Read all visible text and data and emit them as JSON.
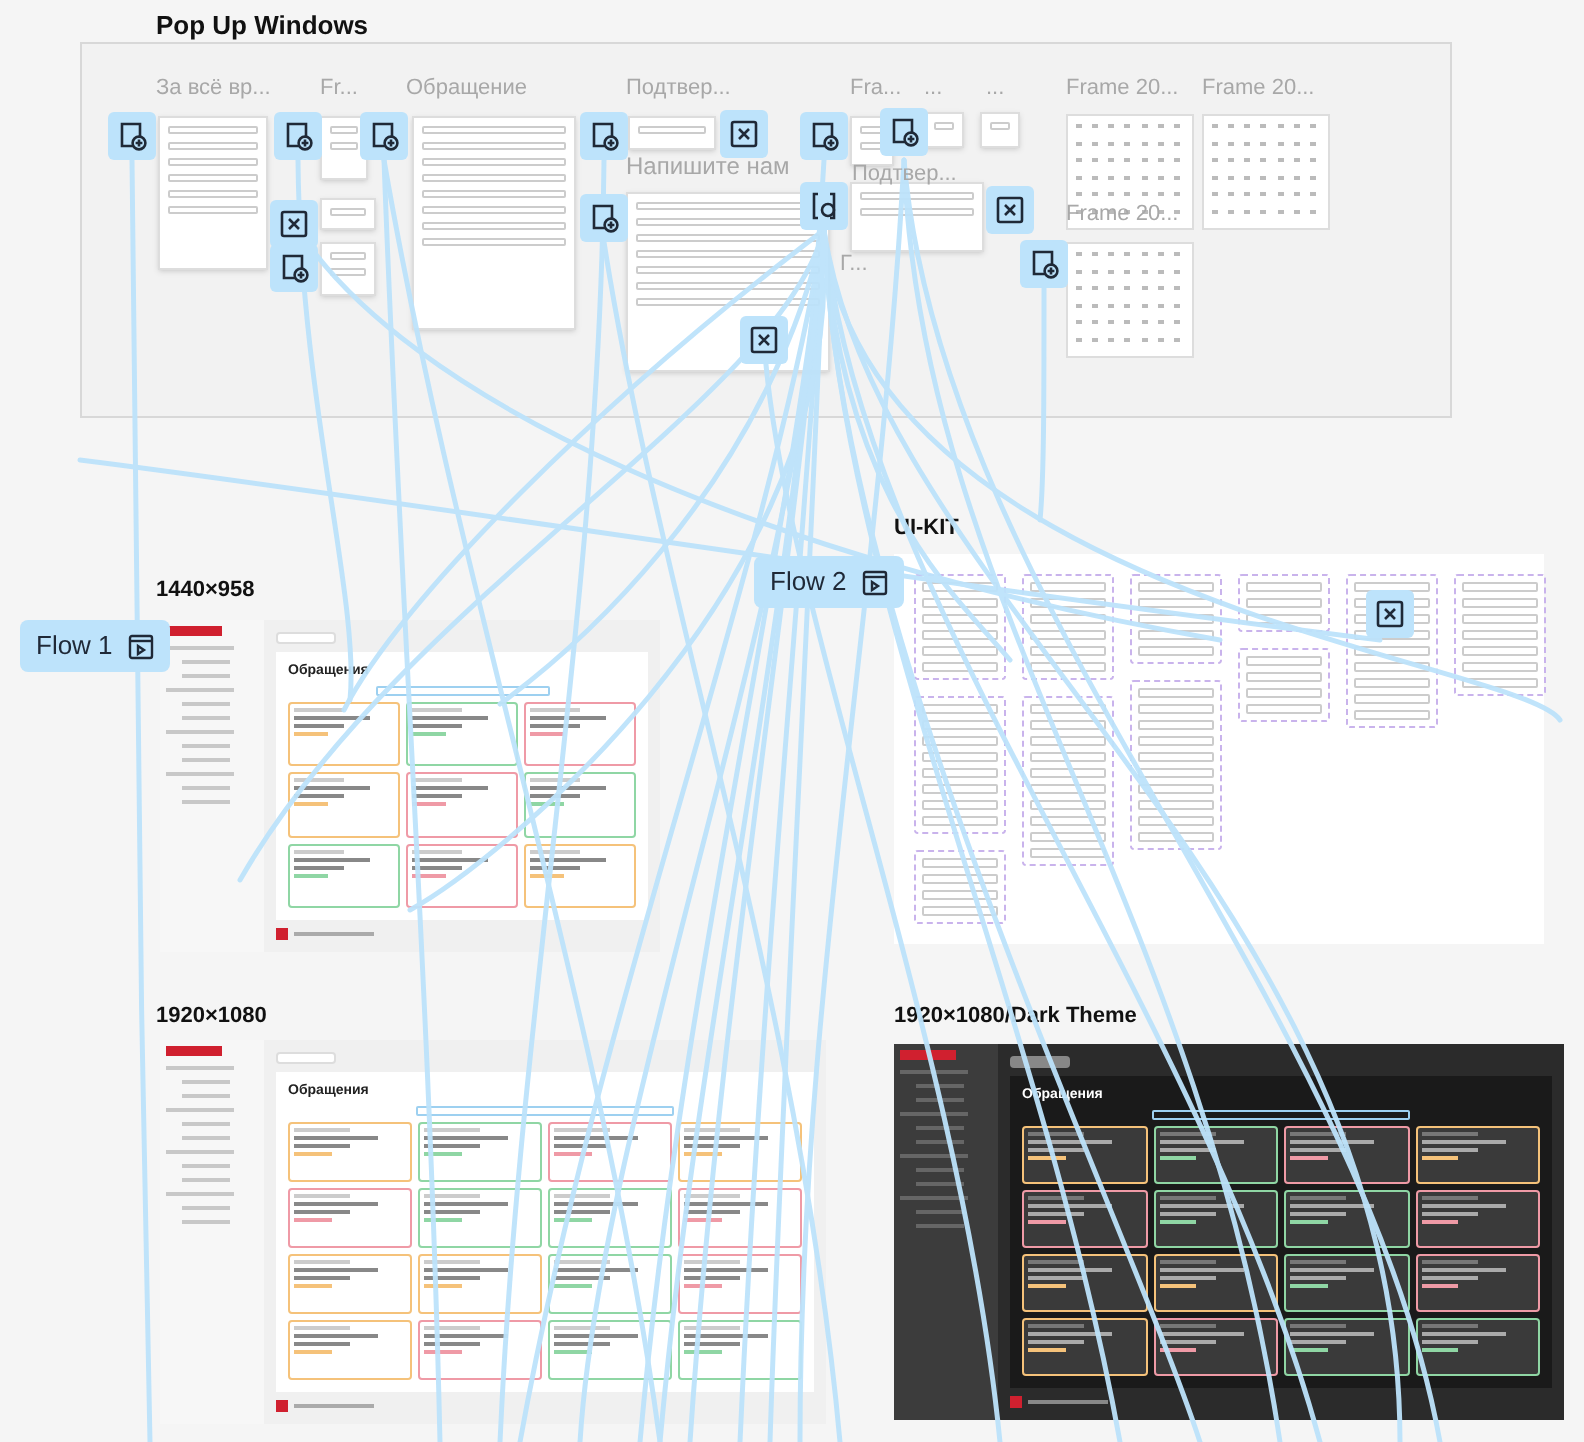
{
  "popup_section": {
    "title": "Pop Up Windows",
    "frame_labels": [
      {
        "text": "За всё вр..."
      },
      {
        "text": "Fr..."
      },
      {
        "text": "Обращение"
      },
      {
        "text": "Подтвер..."
      },
      {
        "text": "Fra..."
      },
      {
        "text": "..."
      },
      {
        "text": "..."
      },
      {
        "text": "Frame 20..."
      },
      {
        "text": "Frame 20..."
      },
      {
        "text": "Напишите нам"
      },
      {
        "text": "Подтвер..."
      },
      {
        "text": "Frame 20..."
      },
      {
        "text": "Г..."
      }
    ]
  },
  "flows": [
    {
      "label": "Flow 1"
    },
    {
      "label": "Flow 2"
    }
  ],
  "frames": [
    {
      "title": "UI-KIT",
      "kind": "kit"
    },
    {
      "title": "1440×958",
      "kind": "light",
      "heading": "Обращения"
    },
    {
      "title": "1920×1080",
      "kind": "light",
      "heading": "Обращения"
    },
    {
      "title": "1920×1080/Dark Theme",
      "kind": "dark",
      "heading": "Обращения"
    }
  ]
}
